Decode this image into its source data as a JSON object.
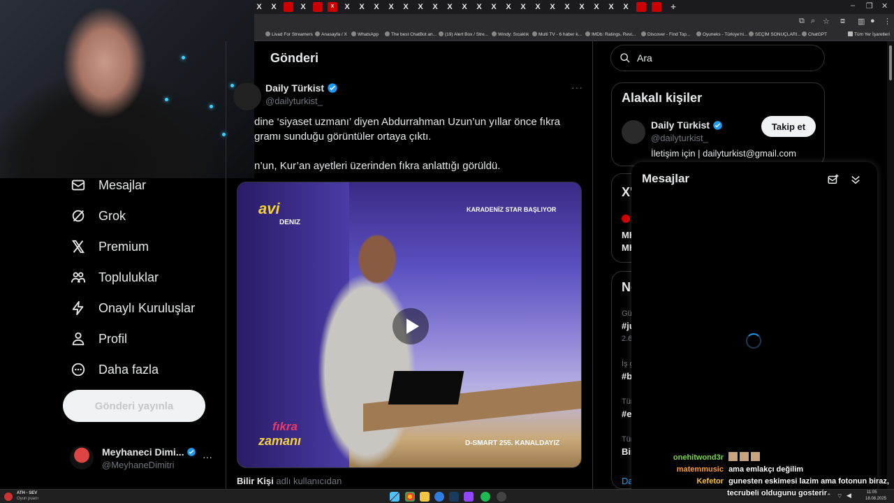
{
  "browser": {
    "tabs": [
      "X",
      "X",
      "",
      "X",
      "",
      "X",
      "X",
      "X",
      "X",
      "X",
      "X",
      "X",
      "X",
      "X",
      "X",
      "X",
      "X",
      "X",
      "X",
      "X",
      "X",
      "X",
      "X",
      "X",
      "X",
      "X",
      "",
      ""
    ],
    "new_tab": "+",
    "window_controls": [
      "–",
      "❐",
      "✕"
    ],
    "bookmarks": [
      "Livad For Streamers",
      "Anasayfa / X",
      "WhatsApp",
      "The best ChatBot an...",
      "(19) Alert Box / Stre...",
      "Windy: Sıcaklık",
      "Multi TV - 6 haber k...",
      "IMDb: Ratings, Revi...",
      "Discover - Find Top...",
      "Oyuneks - Türkiye'ni...",
      "SEÇİM SONUÇLARI...",
      "ChatGPT"
    ],
    "all_bookmarks": "Tüm Yer İşaretleri"
  },
  "nav": {
    "items": [
      {
        "label": "Mesajlar",
        "icon": "envelope-icon"
      },
      {
        "label": "Grok",
        "icon": "grok-icon"
      },
      {
        "label": "Premium",
        "icon": "x-logo-icon"
      },
      {
        "label": "Topluluklar",
        "icon": "people-icon"
      },
      {
        "label": "Onaylı Kuruluşlar",
        "icon": "lightning-icon"
      },
      {
        "label": "Profil",
        "icon": "person-icon"
      },
      {
        "label": "Daha fazla",
        "icon": "more-circle-icon"
      }
    ],
    "post_button": "Gönderi yayınla",
    "account": {
      "name": "Meyhaneci Dimi...",
      "handle": "@MeyhaneDimitri",
      "more": "···"
    }
  },
  "main": {
    "title": "Gönderi",
    "tweet": {
      "name": "Daily Türkist",
      "handle": "@dailyturkist_",
      "more": "···",
      "lines": [
        "dine ‘siyaset uzmanı’ diyen Abdurrahman Uzun’un yıllar önce fıkra",
        "gramı sunduğu görüntüler ortaya çıktı.",
        "n’un, Kur’an ayetleri üzerinden fıkra anlattığı görüldü."
      ],
      "video_overlays": {
        "logo": "avi",
        "logo_sub": "DENIZ",
        "banner": "KARADENİZ STAR BAŞLIYOR",
        "show_top": "fıkra",
        "show_bottom": "zamanı",
        "channel": "D-SMART 255. KANALDAYIZ"
      },
      "caption_bold": "Bilir Kişi",
      "caption_rest": "adlı kullanıcıdan"
    }
  },
  "right": {
    "search_placeholder": "Ara",
    "related": {
      "title": "Alakalı kişiler",
      "name": "Daily Türkist",
      "handle": "@dailyturkist_",
      "bio": "İletişim için | dailyturkist@gmail.com",
      "follow": "Takip et"
    },
    "peek": {
      "x_title": "X'",
      "mh1": "MH",
      "mh2": "MH",
      "no": "Ne",
      "gu": "Gü",
      "t1": "#ju",
      "n1": "2.6",
      "is": "İş g",
      "t2": "#b",
      "tu1": "Tür",
      "t3": "#e",
      "tu2": "Tür",
      "bir": "Bir",
      "da": "Da"
    }
  },
  "messages": {
    "title": "Mesajlar"
  },
  "chat": [
    {
      "user": "onehitwond3r",
      "msg": "",
      "color": "#7cd34a"
    },
    {
      "user": "matemmusic",
      "msg": "ama emlakçı değilim",
      "color": "#ff9a2e"
    },
    {
      "user": "Kefetor",
      "msg": "gunesten eskimesi lazim ama fotonun biraz,",
      "color": "#ffc12e"
    },
    {
      "user": "",
      "msg": "tecrubeli oldugunu gosterir",
      "color": "#ffffff"
    }
  ],
  "taskbar": {
    "weather_title": "ATH - SEV",
    "weather_sub": "Oyun puanı",
    "time": "11:05",
    "date": "18.08.2025"
  }
}
